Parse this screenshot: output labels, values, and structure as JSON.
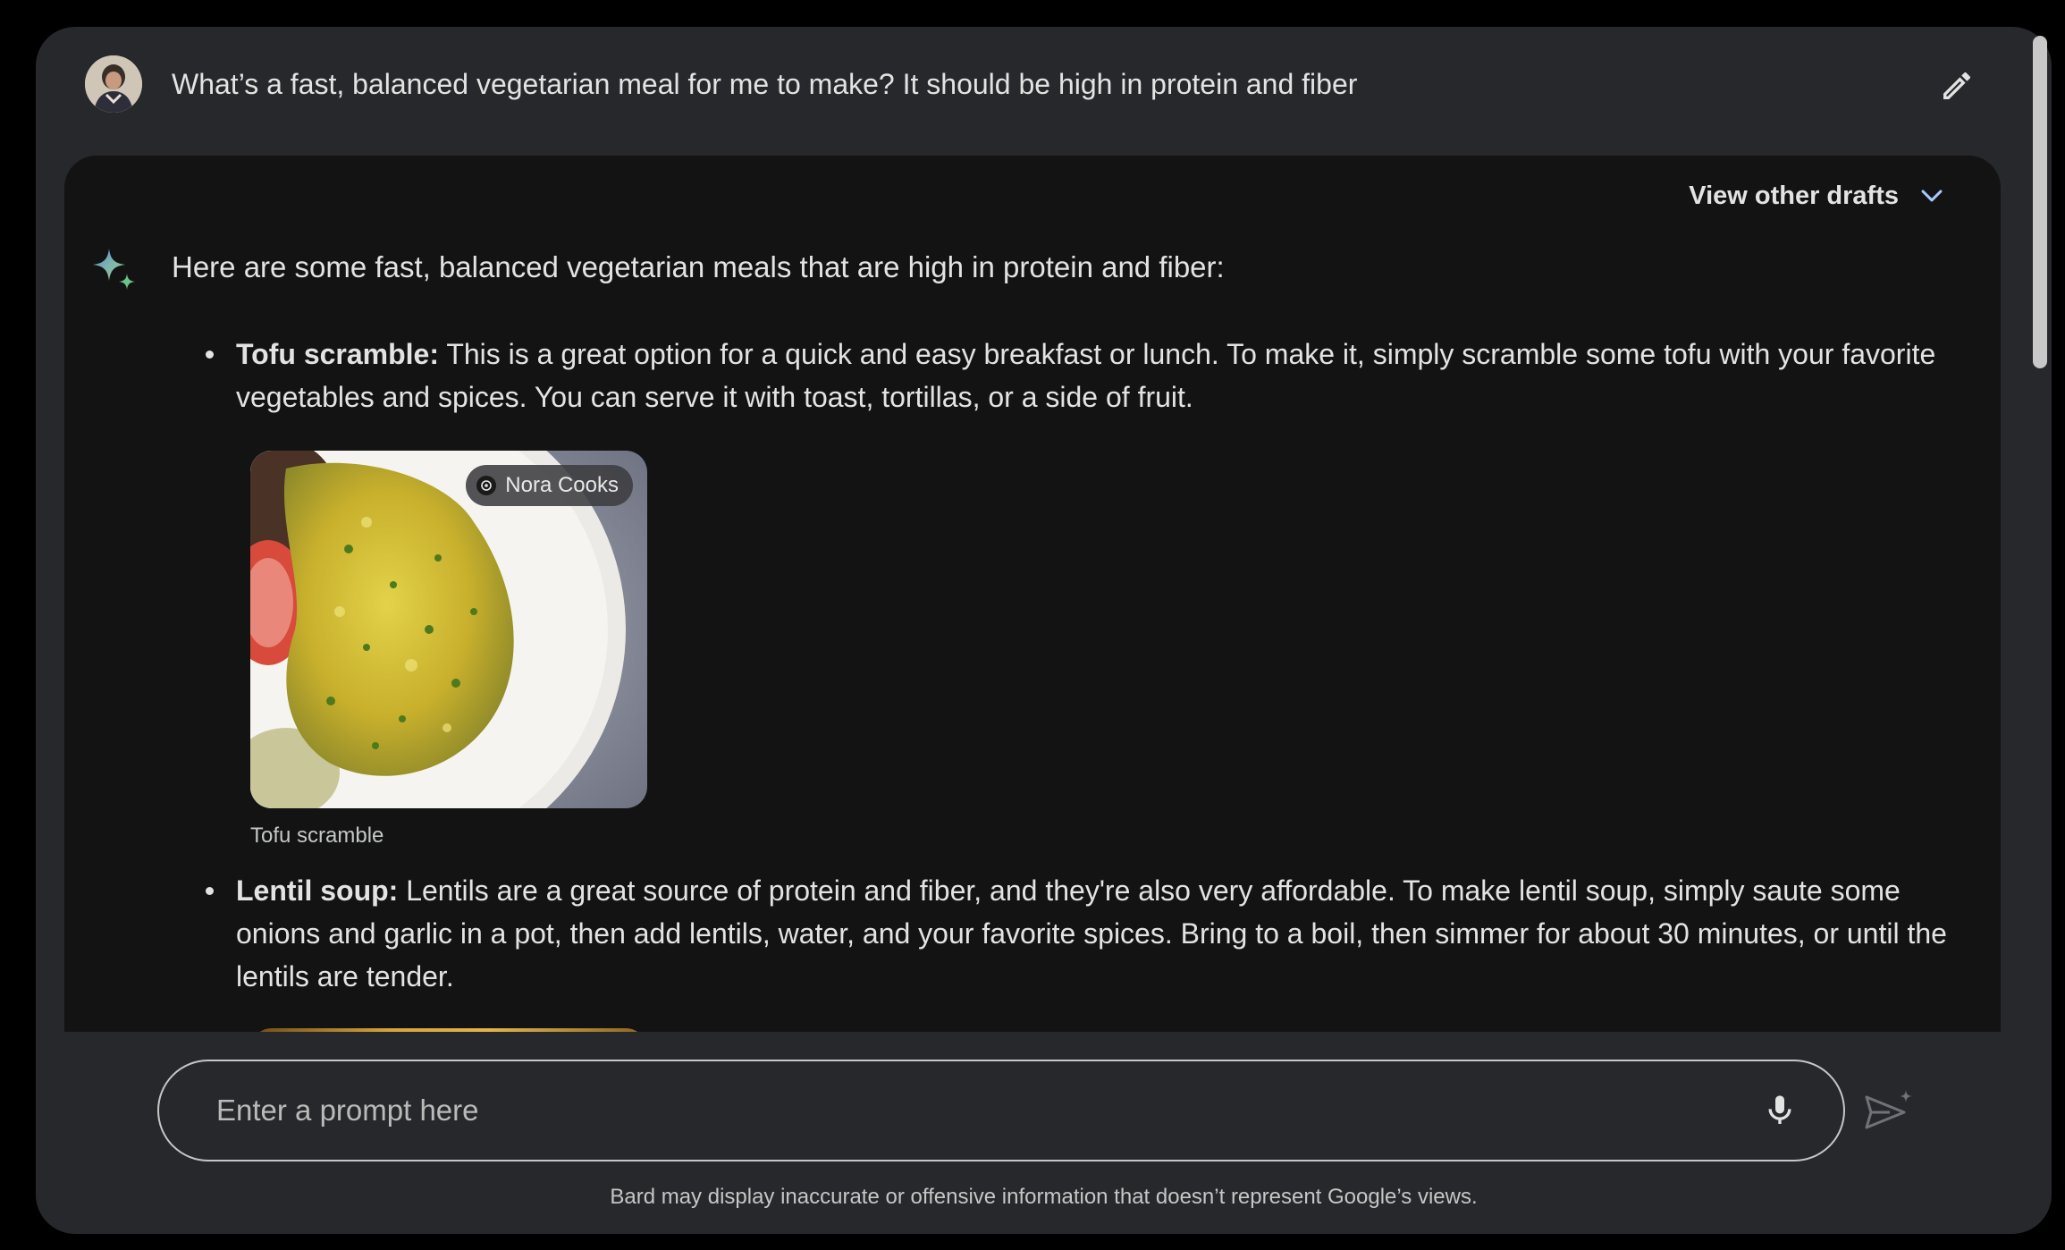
{
  "conversation": {
    "user_prompt": "What’s a fast, balanced vegetarian meal for me to make? It should be high in protein and fiber",
    "edit_icon": "pencil-icon"
  },
  "response": {
    "drafts_label": "View other drafts",
    "intro": "Here are some fast, balanced vegetarian meals that are high in protein and fiber:",
    "items": [
      {
        "title": "Tofu scramble:",
        "text": " This is a great option for a quick and easy breakfast or lunch. To make it, simply scramble some tofu with your favorite vegetables and spices. You can serve it with toast, tortillas, or a side of fruit.",
        "image_source": "Nora Cooks",
        "image_caption": "Tofu scramble"
      },
      {
        "title": "Lentil soup:",
        "text": " Lentils are a great source of protein and fiber, and they're also very affordable. To make lentil soup, simply saute some onions and garlic in a pot, then add lentils, water, and your favorite spices. Bring to a boil, then simmer for about 30 minutes, or until the lentils are tender."
      }
    ]
  },
  "input": {
    "placeholder": "Enter a prompt here"
  },
  "footer": {
    "disclaimer": "Bard may display inaccurate or offensive information that doesn’t represent Google’s views."
  },
  "colors": {
    "background": "#000000",
    "window": "#27282c",
    "card": "#131314",
    "text": "#e3e3e3",
    "accent_blue": "#a8c7fa"
  }
}
